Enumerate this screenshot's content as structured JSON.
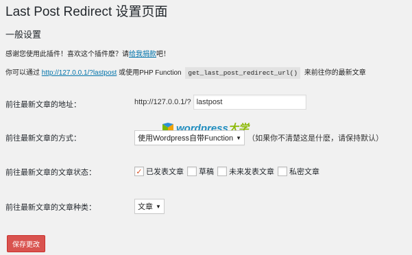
{
  "page": {
    "title_main": "Last Post Redirect",
    "title_suffix": "设置页面",
    "section_title": "一般设置"
  },
  "intro": {
    "text_before": "感谢您使用此插件！喜欢这个插件麽？请",
    "link_text": "给我捐款",
    "text_after": "吧！"
  },
  "usage": {
    "prefix": "你可以通过",
    "link": "http://127.0.0.1/?lastpost",
    "middle": "或使用PHP Function",
    "code": "get_last_post_redirect_url()",
    "suffix": "来前往你的最新文章"
  },
  "fields": {
    "address_label": "前往最新文章的地址：",
    "address_prefix": "http://127.0.0.1/?",
    "address_value": "lastpost",
    "method_label": "前往最新文章的方式：",
    "method_selected": "使用Wordpress自带Function",
    "method_hint": "（如果你不清楚这是什麽，请保持默认）",
    "status_label": "前往最新文章的文章状态：",
    "status_options": [
      {
        "label": "已发表文章",
        "checked": true
      },
      {
        "label": "草稿",
        "checked": false
      },
      {
        "label": "未来发表文章",
        "checked": false
      },
      {
        "label": "私密文章",
        "checked": false
      }
    ],
    "type_label": "前往最新文章的文章种类：",
    "type_selected": "文章"
  },
  "actions": {
    "save_label": "保存更改"
  },
  "watermark": {
    "text_a": "wordpress",
    "text_b": "大学"
  },
  "colors": {
    "link": "#0073aa",
    "save_button": "#d9534f",
    "background": "#f1f1f1"
  }
}
